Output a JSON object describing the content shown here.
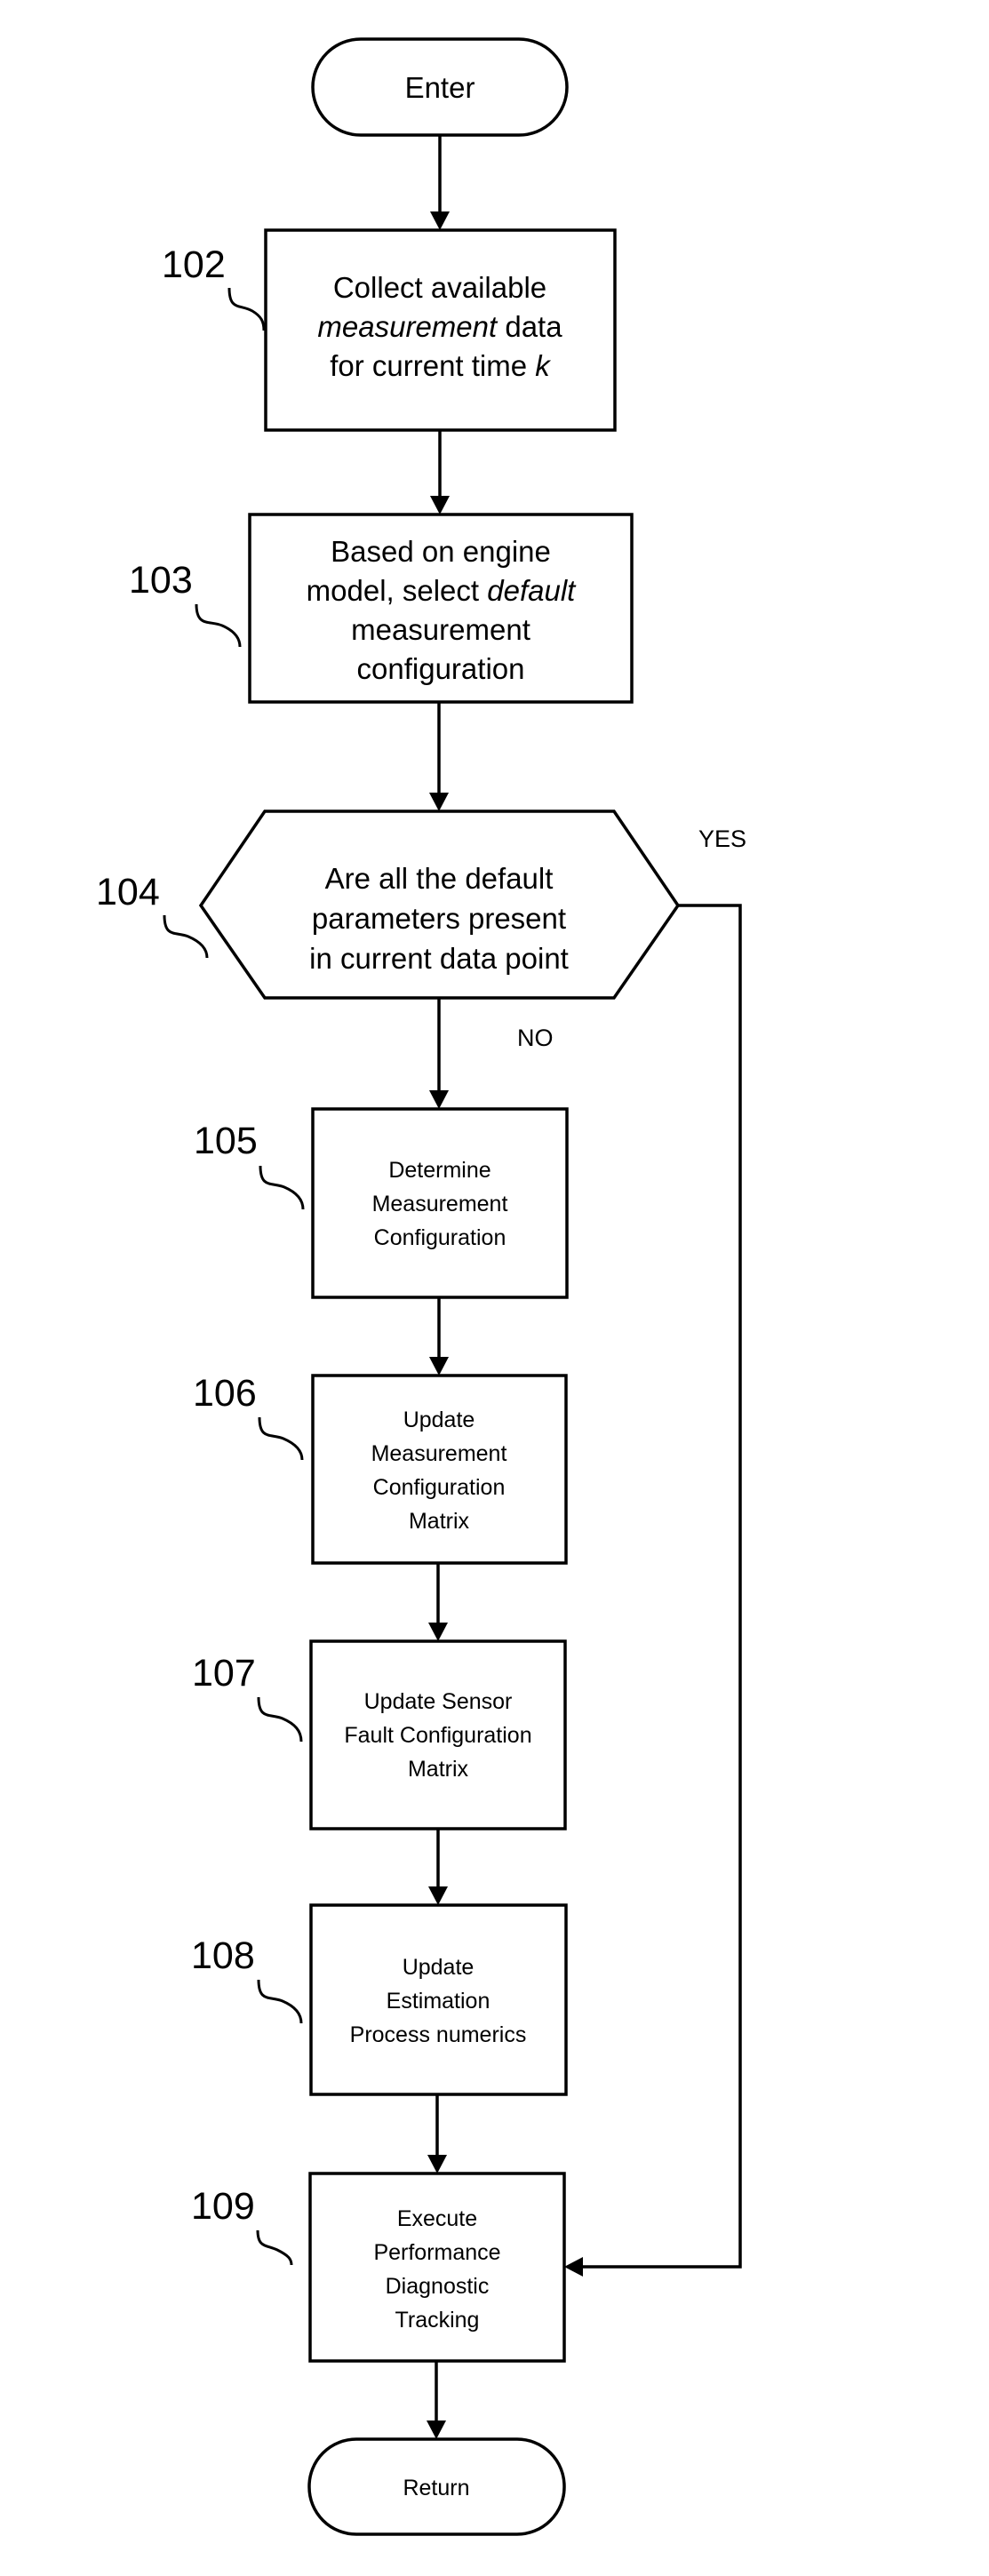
{
  "diagram_type": "flowchart",
  "terminals": {
    "start": {
      "label": "Enter"
    },
    "end": {
      "label": "Return"
    }
  },
  "steps": [
    {
      "ref": "102",
      "kind": "process",
      "lines": [
        [
          {
            "text": "Collect available",
            "italic": false
          }
        ],
        [
          {
            "text": "measurement",
            "italic": true
          },
          {
            "text": " data",
            "italic": false
          }
        ],
        [
          {
            "text": "for current time ",
            "italic": false
          },
          {
            "text": "k",
            "italic": true
          }
        ]
      ]
    },
    {
      "ref": "103",
      "kind": "process",
      "lines": [
        [
          {
            "text": "Based on engine",
            "italic": false
          }
        ],
        [
          {
            "text": "model, select ",
            "italic": false
          },
          {
            "text": "default",
            "italic": true
          }
        ],
        [
          {
            "text": "measurement",
            "italic": false
          }
        ],
        [
          {
            "text": "configuration",
            "italic": false
          }
        ]
      ]
    },
    {
      "ref": "104",
      "kind": "decision",
      "lines": [
        [
          {
            "text": "Are all the default",
            "italic": false
          }
        ],
        [
          {
            "text": "parameters present",
            "italic": false
          }
        ],
        [
          {
            "text": "in current data point",
            "italic": false
          }
        ]
      ],
      "yes_label": "YES",
      "no_label": "NO"
    },
    {
      "ref": "105",
      "kind": "process",
      "lines": [
        [
          {
            "text": "Determine",
            "italic": false
          }
        ],
        [
          {
            "text": "Measurement",
            "italic": false
          }
        ],
        [
          {
            "text": "Configuration",
            "italic": false
          }
        ]
      ]
    },
    {
      "ref": "106",
      "kind": "process",
      "lines": [
        [
          {
            "text": "Update",
            "italic": false
          }
        ],
        [
          {
            "text": "Measurement",
            "italic": false
          }
        ],
        [
          {
            "text": "Configuration",
            "italic": false
          }
        ],
        [
          {
            "text": "Matrix",
            "italic": false
          }
        ]
      ]
    },
    {
      "ref": "107",
      "kind": "process",
      "lines": [
        [
          {
            "text": "Update Sensor",
            "italic": false
          }
        ],
        [
          {
            "text": "Fault Configuration",
            "italic": false
          }
        ],
        [
          {
            "text": "Matrix",
            "italic": false
          }
        ]
      ]
    },
    {
      "ref": "108",
      "kind": "process",
      "lines": [
        [
          {
            "text": "Update",
            "italic": false
          }
        ],
        [
          {
            "text": "Estimation",
            "italic": false
          }
        ],
        [
          {
            "text": "Process numerics",
            "italic": false
          }
        ]
      ]
    },
    {
      "ref": "109",
      "kind": "process",
      "lines": [
        [
          {
            "text": "Execute",
            "italic": false
          }
        ],
        [
          {
            "text": "Performance",
            "italic": false
          }
        ],
        [
          {
            "text": "Diagnostic",
            "italic": false
          }
        ],
        [
          {
            "text": "Tracking",
            "italic": false
          }
        ]
      ]
    }
  ],
  "connections": [
    {
      "from": "Enter",
      "to": "102"
    },
    {
      "from": "102",
      "to": "103"
    },
    {
      "from": "103",
      "to": "104"
    },
    {
      "from": "104",
      "to": "105",
      "label": "NO"
    },
    {
      "from": "104",
      "to": "109",
      "label": "YES"
    },
    {
      "from": "105",
      "to": "106"
    },
    {
      "from": "106",
      "to": "107"
    },
    {
      "from": "107",
      "to": "108"
    },
    {
      "from": "108",
      "to": "109"
    },
    {
      "from": "109",
      "to": "Return"
    }
  ]
}
